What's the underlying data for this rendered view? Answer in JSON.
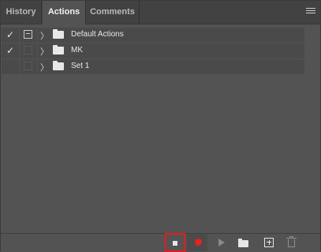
{
  "tabs": [
    {
      "label": "History",
      "active": false
    },
    {
      "label": "Actions",
      "active": true
    },
    {
      "label": "Comments",
      "active": false
    }
  ],
  "panel_menu_icon": "hamburger-menu-icon",
  "action_sets": [
    {
      "label": "Default Actions",
      "checked": true,
      "dialog_toggle": true
    },
    {
      "label": "MK",
      "checked": true,
      "dialog_toggle": false
    },
    {
      "label": "Set 1",
      "checked": false,
      "dialog_toggle": false
    }
  ],
  "toolbar": {
    "buttons": [
      "stop-icon",
      "record-icon",
      "play-icon",
      "new-set-folder-icon",
      "new-action-icon",
      "trash-icon"
    ],
    "highlighted": "stop-icon"
  },
  "colors": {
    "panel_bg": "#535353",
    "row_bg": "#4a4a4a",
    "record": "#e32222",
    "highlight_border": "#e51b1b"
  }
}
